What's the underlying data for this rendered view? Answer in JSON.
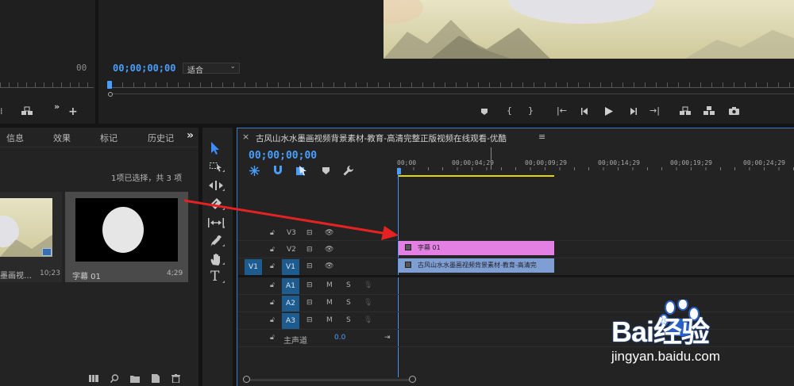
{
  "source_monitor": {
    "timecode_right": "00",
    "icons": [
      "lift-icon",
      "add-icon"
    ]
  },
  "program_monitor": {
    "timecode": "00;00;00;00",
    "zoom_select": "适合",
    "transport": [
      "marker-icon",
      "in-point-icon",
      "out-point-icon",
      "go-to-in-icon",
      "step-back-icon",
      "play-icon",
      "step-forward-icon",
      "go-to-out-icon",
      "lift-icon",
      "extract-icon",
      "export-frame-icon"
    ]
  },
  "project_panel": {
    "tabs": [
      "信息",
      "效果",
      "标记",
      "历史记"
    ],
    "overflow": "»",
    "selection_status": "1项已选择，共 3 项",
    "items": [
      {
        "name": "墨画视…",
        "duration": "10;23"
      },
      {
        "name": "字幕 01",
        "duration": "4;29"
      }
    ],
    "footer_icons": [
      "list-view-icon",
      "search-icon",
      "folder-icon",
      "new-item-icon",
      "trash-icon"
    ]
  },
  "tools": [
    "selection-tool",
    "track-select-tool",
    "ripple-edit-tool",
    "razor-tool",
    "slip-tool",
    "pen-tool",
    "hand-tool",
    "type-tool"
  ],
  "timeline": {
    "close": "×",
    "title": "古风山水水墨画视频背景素材-教育-高清完整正版视频在线观看-优酷",
    "menu": "≡",
    "timecode": "00;00;00;00",
    "ruler": [
      "00;00",
      "00;00;04;29",
      "00;00;09;29",
      "00;00;14;29",
      "00;00;19;29",
      "00;00;24;29"
    ],
    "video_tracks": [
      {
        "target": "",
        "name": "V3"
      },
      {
        "target": "",
        "name": "V2"
      },
      {
        "target": "V1",
        "name": "V1"
      }
    ],
    "audio_tracks": [
      {
        "name": "A1",
        "m": "M",
        "s": "S"
      },
      {
        "name": "A2",
        "m": "M",
        "s": "S"
      },
      {
        "name": "A3",
        "m": "M",
        "s": "S"
      }
    ],
    "master": {
      "label": "主声道",
      "value": "0.0"
    },
    "clips": {
      "title_clip": "字幕 01",
      "video_clip": "古风山水水墨画视频背景素材-教育-高清完"
    },
    "colors": {
      "title_clip": "#e480e4",
      "video_clip": "#7f9fd4",
      "playhead": "#4a9eff",
      "work_area": "#e6d400"
    }
  },
  "watermark": {
    "brand_text": "Bai经验",
    "url": "jingyan.baidu.com"
  }
}
